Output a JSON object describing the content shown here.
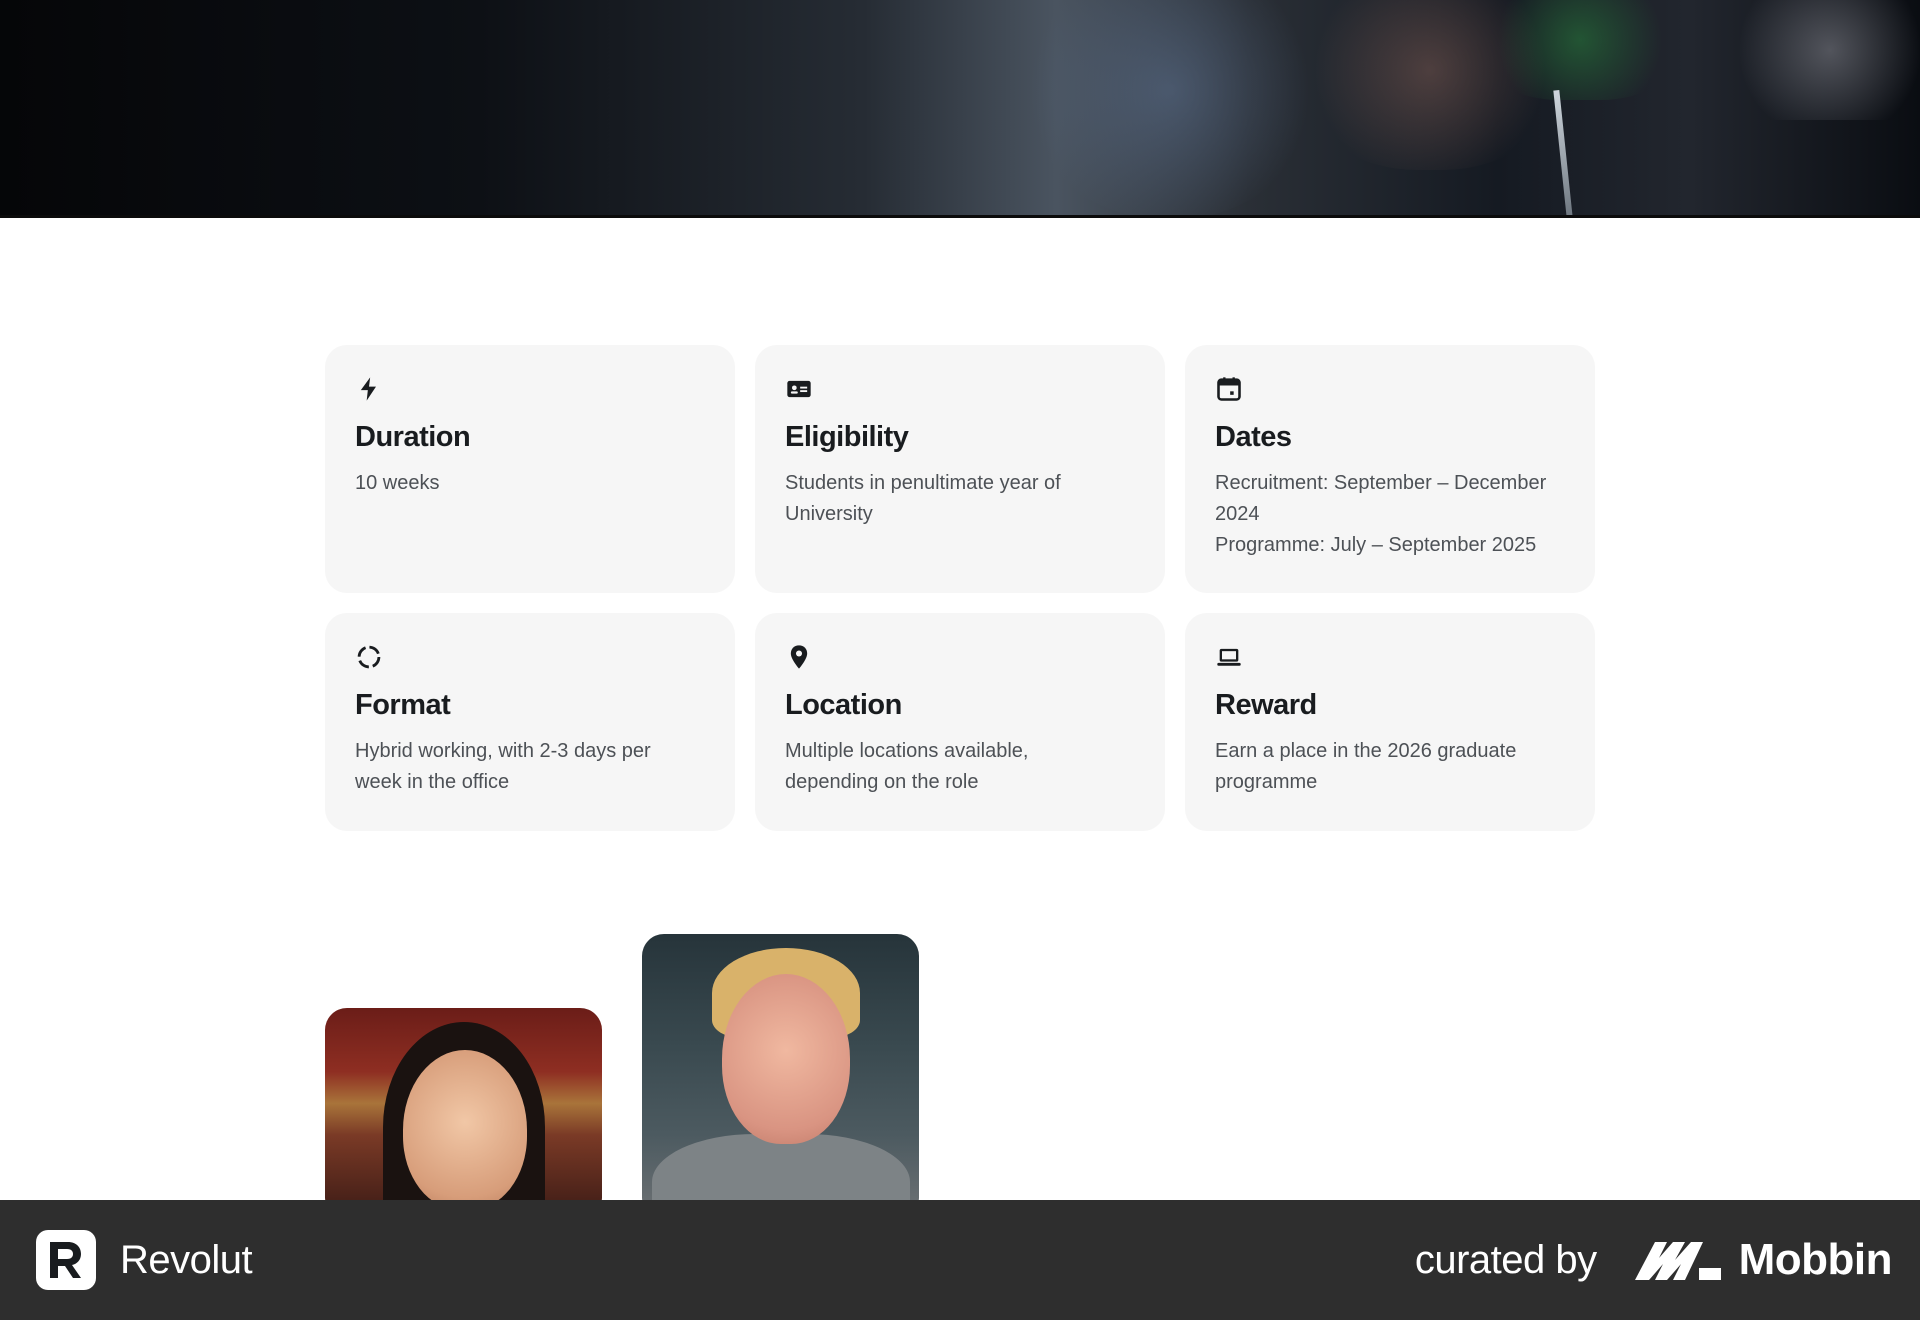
{
  "hero": {
    "alt": ""
  },
  "cards": [
    {
      "icon": "lightning-icon",
      "title": "Duration",
      "lines": [
        "10 weeks"
      ]
    },
    {
      "icon": "id-card-icon",
      "title": "Eligibility",
      "lines": [
        "Students in penultimate year of",
        "University"
      ]
    },
    {
      "icon": "calendar-icon",
      "title": "Dates",
      "lines": [
        "Recruitment: September – December",
        "2024",
        "Programme: July – September 2025"
      ]
    },
    {
      "icon": "loading-circle-icon",
      "title": "Format",
      "lines": [
        "Hybrid working, with 2-3 days per",
        "week in the office"
      ]
    },
    {
      "icon": "location-pin-icon",
      "title": "Location",
      "lines": [
        "Multiple locations available,",
        "depending on the role"
      ]
    },
    {
      "icon": "laptop-icon",
      "title": "Reward",
      "lines": [
        "Earn a place in the 2026 graduate",
        "programme"
      ]
    }
  ],
  "footer": {
    "brand_name": "Revolut",
    "curated_label": "curated by",
    "curator_name": "Mobbin"
  }
}
